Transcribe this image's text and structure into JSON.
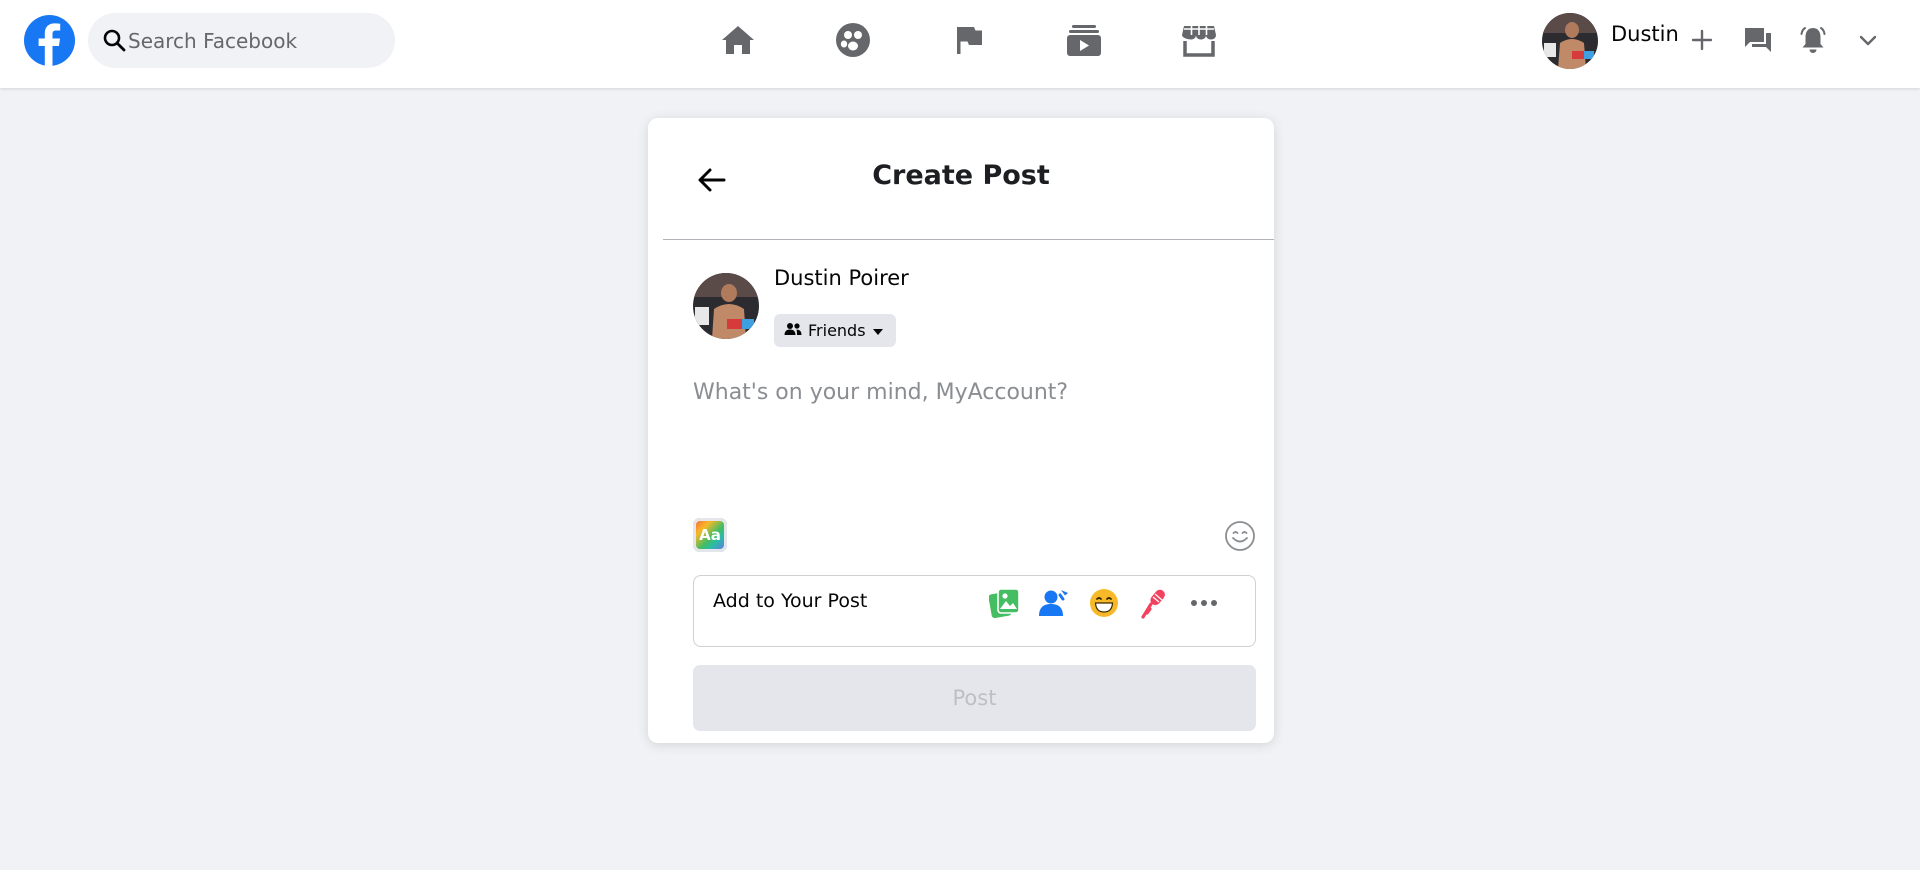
{
  "topbar": {
    "logo": "facebook-logo",
    "search_placeholder": "Search Facebook",
    "nav": [
      {
        "name": "home",
        "icon": "home-icon"
      },
      {
        "name": "groups",
        "icon": "groups-icon"
      },
      {
        "name": "pages",
        "icon": "flag-icon"
      },
      {
        "name": "watch",
        "icon": "watch-icon"
      },
      {
        "name": "marketplace",
        "icon": "marketplace-icon"
      }
    ],
    "user_name": "Dustin",
    "actions": [
      "plus-icon",
      "messenger-icon",
      "notifications-icon",
      "chevron-down-icon"
    ]
  },
  "create_post": {
    "title": "Create Post",
    "author_name": "Dustin Poirer",
    "audience": "Friends",
    "composer_placeholder": "What's on your mind, MyAccount?",
    "text_format_label": "Aa",
    "add_to_post_label": "Add to Your Post",
    "add_options": [
      "photo-video-icon",
      "tag-people-icon",
      "feeling-icon",
      "live-video-icon",
      "more-icon"
    ],
    "post_button_label": "Post"
  },
  "colors": {
    "brand": "#1877f2",
    "background": "#f0f2f5",
    "photo": "#45bd62",
    "tag": "#1877f2",
    "feeling": "#f7b928",
    "live": "#f3425f",
    "disabled_button": "#e4e6eb"
  }
}
